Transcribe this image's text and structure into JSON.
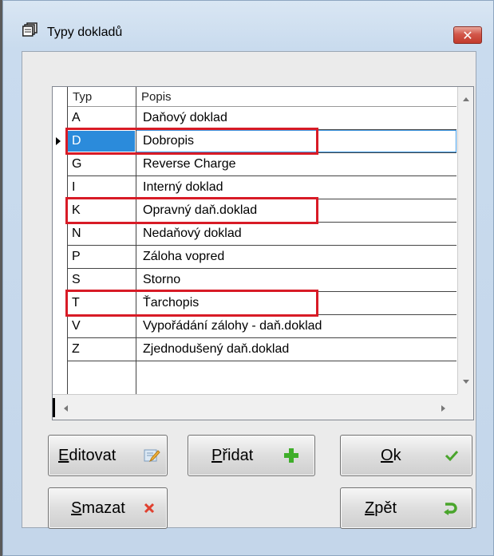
{
  "window": {
    "title": "Typy dokladů",
    "close_glyph": "✕"
  },
  "grid": {
    "columns": [
      "Typ",
      "Popis"
    ],
    "rows": [
      {
        "typ": "A",
        "popis": "Daňový doklad"
      },
      {
        "typ": "D",
        "popis": "Dobropis"
      },
      {
        "typ": "G",
        "popis": "Reverse Charge"
      },
      {
        "typ": "I",
        "popis": "Interný doklad"
      },
      {
        "typ": "K",
        "popis": "Opravný daň.doklad"
      },
      {
        "typ": "N",
        "popis": "Nedaňový doklad"
      },
      {
        "typ": "P",
        "popis": "Záloha vopred"
      },
      {
        "typ": "S",
        "popis": "Storno"
      },
      {
        "typ": "T",
        "popis": "Ťarchopis"
      },
      {
        "typ": "V",
        "popis": "Vypořádání zálohy - daň.doklad"
      },
      {
        "typ": "Z",
        "popis": "Zjednodušený daň.doklad"
      }
    ],
    "selected_row": "D",
    "highlighted_rows": [
      "D",
      "K",
      "T"
    ]
  },
  "buttons": {
    "edit": {
      "accel": "E",
      "rest": "ditovat",
      "icon": "edit-icon"
    },
    "add": {
      "accel": "P",
      "rest": "řidat",
      "icon": "plus-icon"
    },
    "ok": {
      "accel": "O",
      "rest": "k",
      "icon": "check-icon"
    },
    "delete": {
      "accel": "S",
      "rest": "mazat",
      "icon": "x-icon"
    },
    "back": {
      "accel": "Z",
      "rest": "pět",
      "icon": "undo-icon"
    }
  },
  "colors": {
    "highlight": "#d81b26",
    "selection": "#2b8bdb"
  }
}
